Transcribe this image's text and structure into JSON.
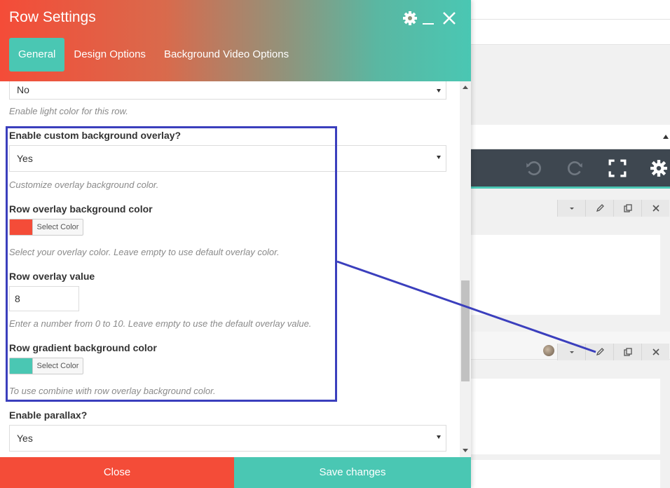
{
  "modal": {
    "title": "Row Settings",
    "tabs": [
      {
        "label": "General",
        "active": true
      },
      {
        "label": "Design Options",
        "active": false
      },
      {
        "label": "Background Video Options",
        "active": false
      }
    ]
  },
  "fields": {
    "light_color": {
      "value": "No",
      "help": "Enable light color for this row."
    },
    "custom_overlay": {
      "label": "Enable custom background overlay?",
      "value": "Yes",
      "help": "Customize overlay background color."
    },
    "overlay_color": {
      "label": "Row overlay background color",
      "button": "Select Color",
      "swatch": "#f44c38",
      "help": "Select your overlay color. Leave empty to use default overlay color."
    },
    "overlay_value": {
      "label": "Row overlay value",
      "value": "8",
      "help": "Enter a number from 0 to 10. Leave empty to use the default overlay value."
    },
    "gradient_color": {
      "label": "Row gradient background color",
      "button": "Select Color",
      "swatch": "#4ac7b3",
      "help": "To use combine with row overlay background color."
    },
    "parallax": {
      "label": "Enable parallax?",
      "value": "Yes"
    }
  },
  "footer": {
    "close_label": "Close",
    "save_label": "Save changes"
  },
  "colors": {
    "accent_red": "#f44c38",
    "accent_teal": "#4ac7b3",
    "annotation_blue": "#3b3fbd",
    "editor_toolbar": "#3e4750"
  },
  "icons": {
    "header": [
      "gear-icon",
      "minimize-icon",
      "close-icon"
    ],
    "editor_toolbar": [
      "undo-icon",
      "redo-icon",
      "fullscreen-icon",
      "gear-icon"
    ],
    "row_controls": [
      "chevron-down-icon",
      "pencil-icon",
      "duplicate-icon",
      "close-icon"
    ]
  }
}
